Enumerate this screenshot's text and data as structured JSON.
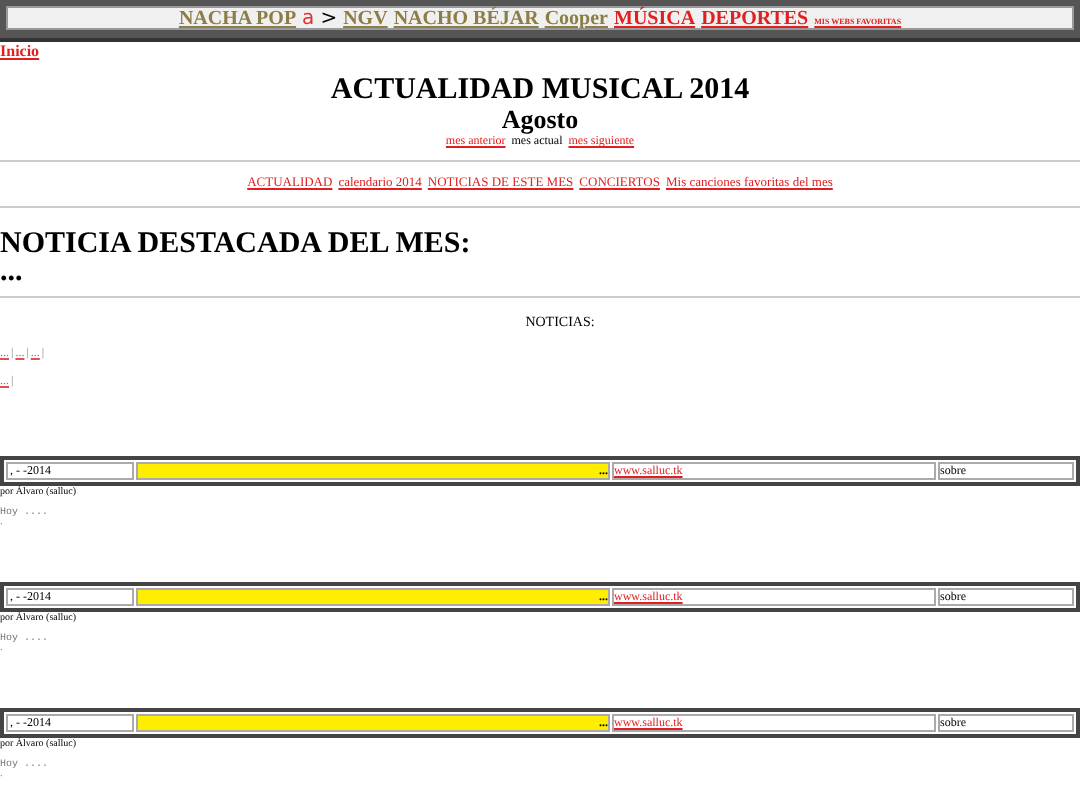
{
  "top_bar": {
    "links": [
      {
        "text": "NACHA POP",
        "color": "#8b7d45",
        "kind": "normal"
      },
      {
        "text": "a",
        "color": "#e03030",
        "kind": "logo"
      },
      {
        "text": ">",
        "color": "#000000",
        "kind": "logo"
      },
      {
        "text": "NGV",
        "color": "#8b7d45",
        "kind": "normal"
      },
      {
        "text": "NACHO BÉJAR",
        "color": "#8b7d45",
        "kind": "normal"
      },
      {
        "text": "Cooper",
        "color": "#8b7d45",
        "kind": "normal"
      },
      {
        "text": "MÚSICA",
        "color": "#e02020",
        "kind": "normal"
      },
      {
        "text": "DEPORTES",
        "color": "#e02020",
        "kind": "normal"
      },
      {
        "text": "MIS WEBS FAVORITAS",
        "color": "#e02020",
        "kind": "tiny"
      }
    ]
  },
  "home_link": "Inicio",
  "title": "ACTUALIDAD MUSICAL 2014",
  "month": "Agosto",
  "month_nav": [
    {
      "text": "mes anterior",
      "kind": "link"
    },
    {
      "text": "mes actual",
      "kind": "plain"
    },
    {
      "text": "mes siguiente",
      "kind": "link"
    }
  ],
  "section_nav": [
    "ACTUALIDAD",
    "calendario 2014",
    "NOTICIAS DE ESTE MES",
    "CONCIERTOS",
    "Mis canciones favoritas del mes"
  ],
  "featured": {
    "heading": "NOTICIA DESTACADA DEL MES:",
    "text": "..."
  },
  "news": {
    "label": "NOTICIAS:",
    "separator": "|",
    "rows": [
      [
        "...",
        "...",
        "..."
      ],
      [
        "..."
      ]
    ]
  },
  "posts": [
    {
      "date": ", - -2014",
      "title": "...",
      "site": "www.salluc.tk",
      "about": "sobre",
      "author": "por Álvaro (salluc)",
      "body": "Hoy ....",
      "end": "."
    },
    {
      "date": ", - -2014",
      "title": "...",
      "site": "www.salluc.tk",
      "about": "sobre",
      "author": "por Álvaro (salluc)",
      "body": "Hoy ....",
      "end": "."
    },
    {
      "date": ", - -2014",
      "title": "...",
      "site": "www.salluc.tk",
      "about": "sobre",
      "author": "por Álvaro (salluc)",
      "body": "Hoy ....",
      "end": "."
    }
  ]
}
